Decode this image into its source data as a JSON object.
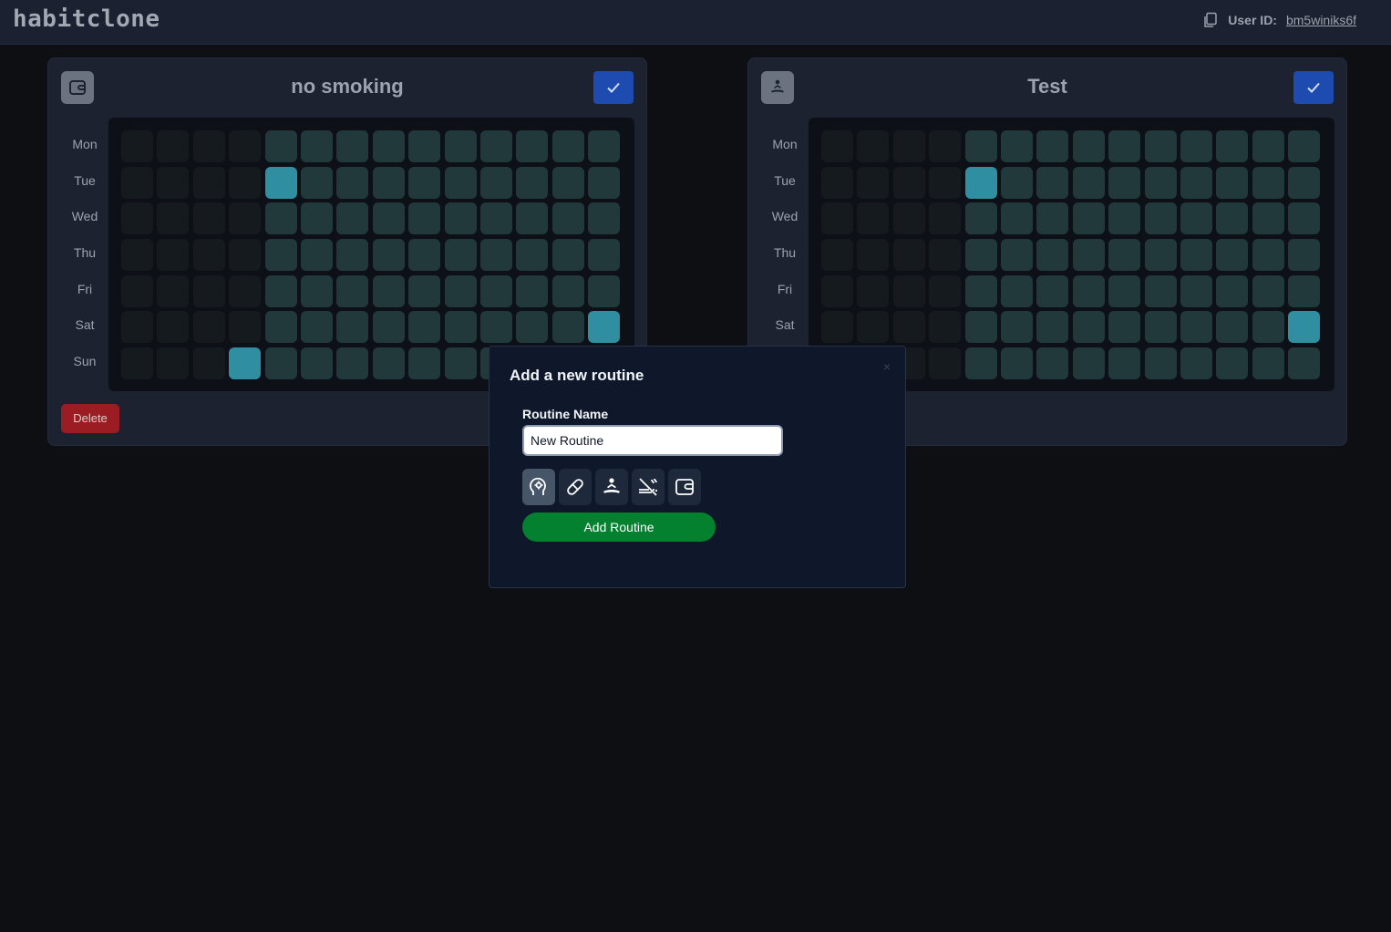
{
  "app": {
    "title": "habitclone"
  },
  "header": {
    "user_id_label": "User ID:",
    "user_id_value": "bm5winiks6f",
    "copy_icon": "copy-icon"
  },
  "days": [
    "Mon",
    "Tue",
    "Wed",
    "Thu",
    "Fri",
    "Sat",
    "Sun"
  ],
  "routines": [
    {
      "title": "no smoking",
      "icon": "wallet-icon",
      "delete_label": "Delete",
      "past_columns": 4,
      "today": {
        "column": 3,
        "day": "Sun"
      },
      "completed": [
        {
          "column": 4,
          "day": "Tue"
        },
        {
          "column": 13,
          "day": "Sat"
        },
        {
          "column": 3,
          "day": "Sun"
        }
      ]
    },
    {
      "title": "Test",
      "icon": "meditation-icon",
      "past_columns": 4,
      "completed": [
        {
          "column": 4,
          "day": "Tue"
        },
        {
          "column": 13,
          "day": "Sat"
        }
      ]
    }
  ],
  "colors": {
    "cell": "#22393b",
    "past_cell": "#151a1f",
    "completed_cell": "#2f8ea0",
    "check_button": "#1e4bb0",
    "delete_button": "#9b1c22",
    "add_button": "#03812f"
  },
  "modal": {
    "title": "Add a new routine",
    "close_label": "×",
    "field_label": "Routine Name",
    "name_value": "New Routine",
    "icon_options": [
      "head-gear-icon",
      "pill-icon",
      "meditation-icon",
      "no-smoking-icon",
      "wallet-icon"
    ],
    "selected_icon": "head-gear-icon",
    "submit_label": "Add Routine"
  }
}
